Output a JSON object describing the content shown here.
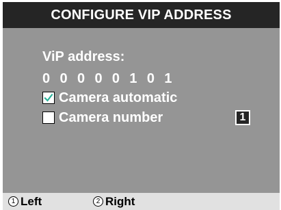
{
  "header": {
    "title": "CONFIGURE VIP ADDRESS"
  },
  "main": {
    "vip_label": "ViP address:",
    "vip_value": "0 0 0 0 0 1 0 1",
    "options": [
      {
        "label": "Camera automatic",
        "checked": true
      },
      {
        "label": "Camera number",
        "checked": false
      }
    ],
    "camera_number": "1"
  },
  "footer": {
    "keys": [
      {
        "number": "1",
        "label": "Left"
      },
      {
        "number": "2",
        "label": "Right"
      }
    ]
  },
  "colors": {
    "header_bg": "#252525",
    "panel_bg": "#959595",
    "footer_bg": "#e1e1e1",
    "check_mark": "#2bb39a"
  }
}
